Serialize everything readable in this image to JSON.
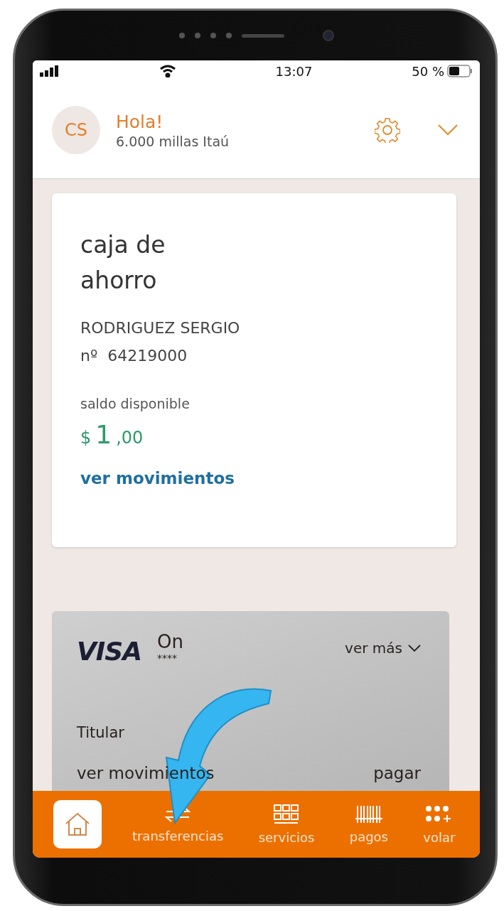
{
  "status_bar": {
    "time": "13:07",
    "battery": "50 %"
  },
  "header": {
    "avatar": "CS",
    "greeting": "Hola!",
    "miles": "6.000 millas Itaú"
  },
  "account": {
    "title": "caja de ahorro",
    "holder": "RODRIGUEZ SERGIO",
    "number": "nº  64219000",
    "balance_label": "saldo disponible",
    "currency": "$",
    "amount": "1",
    "decimals": ",00",
    "link": "ver movimientos"
  },
  "credit_card": {
    "brand": "VISA",
    "name": "On",
    "masked": "****",
    "more": "ver más",
    "holder_label": "Titular",
    "actions": [
      "ver movimientos",
      "pagar"
    ]
  },
  "nav": [
    {
      "kind": "home",
      "selected": true
    },
    {
      "kind": "transfer",
      "label": "transferencias",
      "selected": false
    },
    {
      "kind": "services",
      "label": "servicios",
      "selected": false
    },
    {
      "kind": "payments",
      "label": "pagos",
      "selected": false
    },
    {
      "kind": "more",
      "label": "volar",
      "selected": false
    }
  ]
}
